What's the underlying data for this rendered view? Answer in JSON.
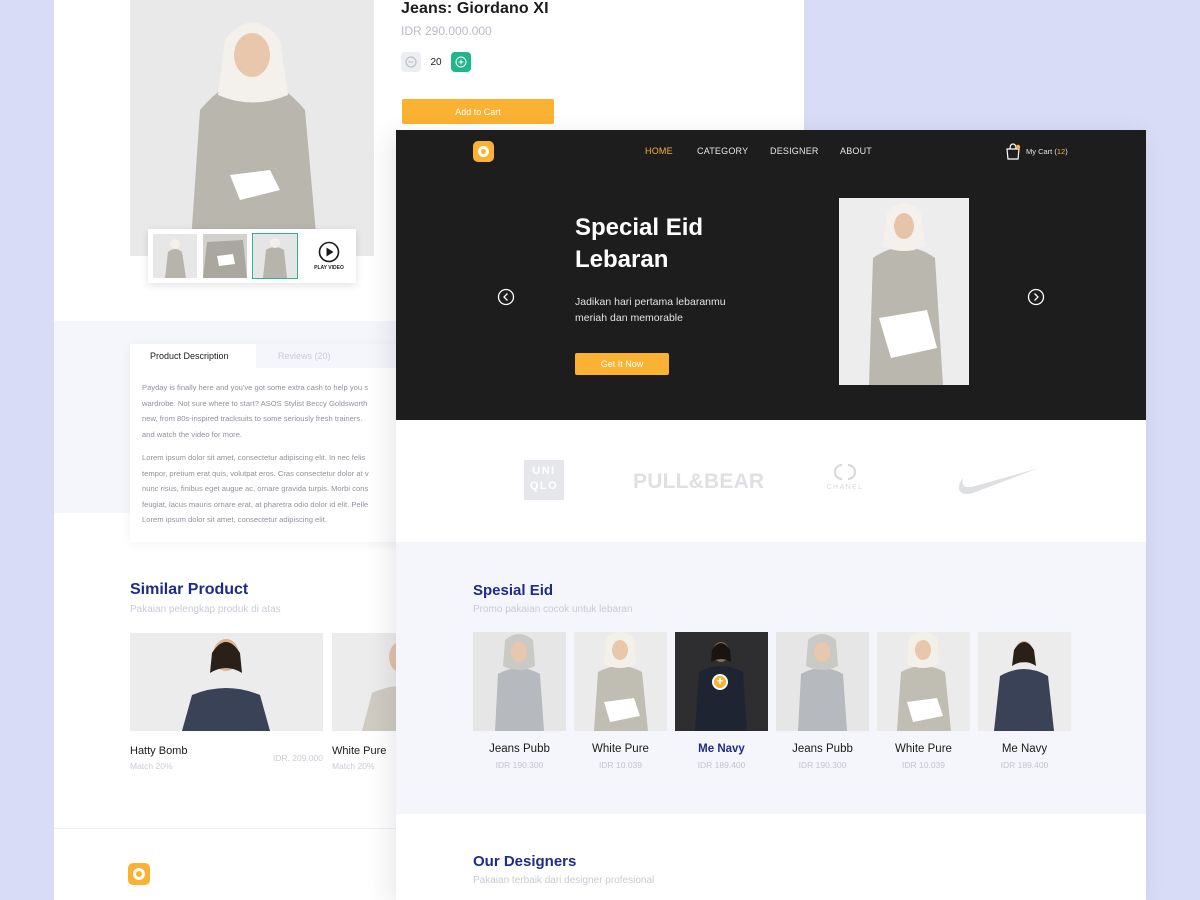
{
  "product": {
    "title": "Jeans: Giordano XI",
    "price": "IDR 290.000.000",
    "quantity": "20",
    "add_to_cart": "Add to Cart",
    "play_video": "PLAY VIDEO"
  },
  "tabs": {
    "description": "Product Description",
    "reviews": "Reviews (20)"
  },
  "description": {
    "lines1": [
      "Payday is finally here and you've got some extra cash to help you  s",
      "wardrobe. Not sure where to start? ASOS Stylist Beccy Goldsworth",
      "new, from 80s-inspired tracksuits to some seriously fresh trainers.",
      "and watch the video for more."
    ],
    "lines2": [
      "Lorem ipsum dolor sit amet, consectetur adipiscing elit. In nec felis",
      "tempor, pretium erat quis, volutpat eros. Cras consectetur dolor at v",
      "nunc risus, finibus eget augue ac, ornare gravida turpis. Morbi cons",
      "feugiat, lacus mauris ornare erat, at pharetra odio dolor id elit. Pelle",
      "Lorem ipsum dolor sit amet, consectetur adipiscing elit."
    ]
  },
  "similar": {
    "title": "Similar Product",
    "subtitle": "Pakaian pelengkap produk di atas",
    "items": [
      {
        "name": "Hatty Bomb",
        "match": "Match 20%",
        "price": "IDR. 209.000"
      },
      {
        "name": "White Pure",
        "match": "Match 20%",
        "price": ""
      }
    ]
  },
  "nav": {
    "items": [
      "HOME",
      "CATEGORY",
      "DESIGNER",
      "ABOUT"
    ],
    "active": "HOME",
    "cart_label": "My Cart (",
    "cart_count": "12",
    "cart_close": ")"
  },
  "hero": {
    "title_line1": "Special Eid",
    "title_line2": "Lebaran",
    "subtitle_line1": "Jadikan hari pertama lebaranmu",
    "subtitle_line2": "meriah dan memorable",
    "cta": "Get It Now"
  },
  "brands": {
    "uniqlo_line1": "UNI",
    "uniqlo_line2": "QLO",
    "pull_bear": "PULL&BEAR",
    "chanel": "CHANEL"
  },
  "eid": {
    "title": "Spesial Eid",
    "subtitle": "Promo pakaian cocok untuk lebaran",
    "items": [
      {
        "name": "Jeans Pubb",
        "price": "IDR 190.300"
      },
      {
        "name": "White Pure",
        "price": "IDR 10.039"
      },
      {
        "name": "Me Navy",
        "price": "IDR 189.400"
      },
      {
        "name": "Jeans Pubb",
        "price": "IDR 190.300"
      },
      {
        "name": "White Pure",
        "price": "IDR 10.039"
      },
      {
        "name": "Me Navy",
        "price": "IDR 189.400"
      }
    ]
  },
  "designers": {
    "title": "Our Designers",
    "subtitle": "Pakaian terbaik dari designer profesional"
  },
  "colors": {
    "accent": "#fbb131",
    "green": "#20b58a",
    "navy": "#1f2b8a",
    "hero_bg": "#1d1d1d",
    "page_bg": "#d9dcf6"
  }
}
